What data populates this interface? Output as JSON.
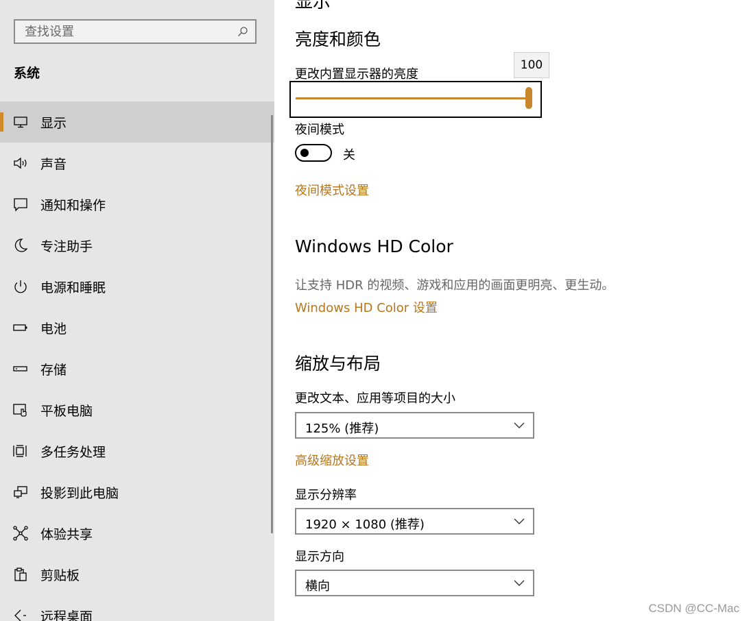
{
  "search": {
    "placeholder": "查找设置"
  },
  "sidebar": {
    "section_title": "系统",
    "items": [
      {
        "label": "显示",
        "icon": "monitor-icon",
        "active": true
      },
      {
        "label": "声音",
        "icon": "speaker-icon"
      },
      {
        "label": "通知和操作",
        "icon": "message-icon"
      },
      {
        "label": "专注助手",
        "icon": "moon-icon"
      },
      {
        "label": "电源和睡眠",
        "icon": "power-icon"
      },
      {
        "label": "电池",
        "icon": "battery-icon"
      },
      {
        "label": "存储",
        "icon": "storage-icon"
      },
      {
        "label": "平板电脑",
        "icon": "tablet-icon"
      },
      {
        "label": "多任务处理",
        "icon": "multitask-icon"
      },
      {
        "label": "投影到此电脑",
        "icon": "project-icon"
      },
      {
        "label": "体验共享",
        "icon": "share-icon"
      },
      {
        "label": "剪贴板",
        "icon": "clipboard-icon"
      },
      {
        "label": "远程桌面",
        "icon": "remote-icon"
      }
    ]
  },
  "main": {
    "cut_heading": "显示",
    "brightness": {
      "heading": "亮度和颜色",
      "label": "更改内置显示器的亮度",
      "value": 100,
      "value_text": "100"
    },
    "night_mode": {
      "label": "夜间模式",
      "state": "关",
      "settings_link": "夜间模式设置"
    },
    "hdr": {
      "heading": "Windows HD Color",
      "description": "让支持 HDR 的视频、游戏和应用的画面更明亮、更生动。",
      "link": "Windows HD Color 设置"
    },
    "scale": {
      "heading": "缩放与布局",
      "size_label": "更改文本、应用等项目的大小",
      "size_value": "125% (推荐)",
      "advanced_link": "高级缩放设置",
      "resolution_label": "显示分辨率",
      "resolution_value": "1920 × 1080 (推荐)",
      "orientation_label": "显示方向",
      "orientation_value": "横向"
    }
  },
  "watermark": "CSDN @CC-Mac",
  "colors": {
    "accent": "#c9862b",
    "link": "#b8761c",
    "sidebar_bg": "#e6e6e6",
    "active_bg": "#cfcfcf"
  }
}
